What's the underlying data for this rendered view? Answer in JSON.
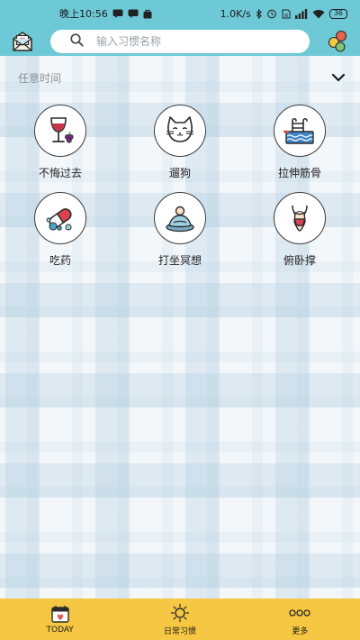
{
  "status_bar": {
    "time": "晚上10:56",
    "network_speed": "1.0K/s",
    "battery": "36"
  },
  "header": {
    "search": {
      "placeholder": "输入习惯名称"
    }
  },
  "section": {
    "title": "任意时间"
  },
  "habits": [
    {
      "label": "不悔过去",
      "icon": "wine-glass-icon"
    },
    {
      "label": "遛狗",
      "icon": "cat-face-icon"
    },
    {
      "label": "拉伸筋骨",
      "icon": "swimming-pool-icon"
    },
    {
      "label": "吃药",
      "icon": "pills-icon"
    },
    {
      "label": "打坐冥想",
      "icon": "meditation-icon"
    },
    {
      "label": "俯卧撑",
      "icon": "body-figure-icon"
    }
  ],
  "bottom_nav": {
    "items": [
      {
        "label": "TODAY",
        "icon": "calendar-heart-icon"
      },
      {
        "label": "日常习惯",
        "icon": "sun-icon"
      },
      {
        "label": "更多",
        "icon": "more-dots-icon"
      }
    ]
  },
  "colors": {
    "header_bg": "#6ec9d7",
    "nav_bg": "#f5c742",
    "background": "#f3f7fa"
  }
}
